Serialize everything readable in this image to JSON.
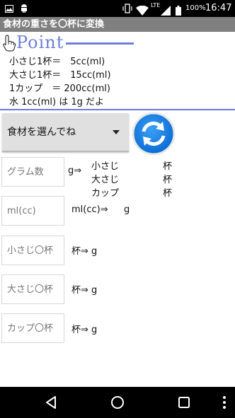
{
  "status_bar": {
    "time": "16:47",
    "battery": "100%",
    "network": "LTE",
    "icons": [
      "image-icon",
      "android-icon",
      "vibrate-icon",
      "wifi-icon",
      "signal-icon",
      "battery-icon"
    ]
  },
  "app": {
    "title": "食材の重さを〇杯に変換"
  },
  "point": {
    "title": "Point",
    "color": "#6d7fd9",
    "lines": [
      "小さじ1杯＝　5cc(ml)",
      "大さじ1杯＝　15cc(ml)",
      "1カップ　＝ 200cc(ml)",
      "水 1cc(ml) は 1g だよ"
    ]
  },
  "selector": {
    "label": "食材を選んでね"
  },
  "fields": {
    "gram": {
      "placeholder": "グラム数",
      "suffix": "g⇒",
      "results": [
        {
          "label": "小さじ",
          "unit": "杯"
        },
        {
          "label": "大さじ",
          "unit": "杯"
        },
        {
          "label": "カップ",
          "unit": "杯"
        }
      ]
    },
    "ml": {
      "placeholder": "ml(cc)",
      "suffix": "ml(cc)⇒",
      "unit": "g"
    },
    "small_spoon": {
      "placeholder": "小さじ〇杯",
      "suffix": "杯⇒ g"
    },
    "large_spoon": {
      "placeholder": "大さじ〇杯",
      "suffix": "杯⇒ g"
    },
    "cup": {
      "placeholder": "カップ〇杯",
      "suffix": "杯⇒ g"
    }
  },
  "nav": {
    "icons": [
      "back-icon",
      "home-icon",
      "recents-icon",
      "overflow-menu-icon"
    ]
  }
}
